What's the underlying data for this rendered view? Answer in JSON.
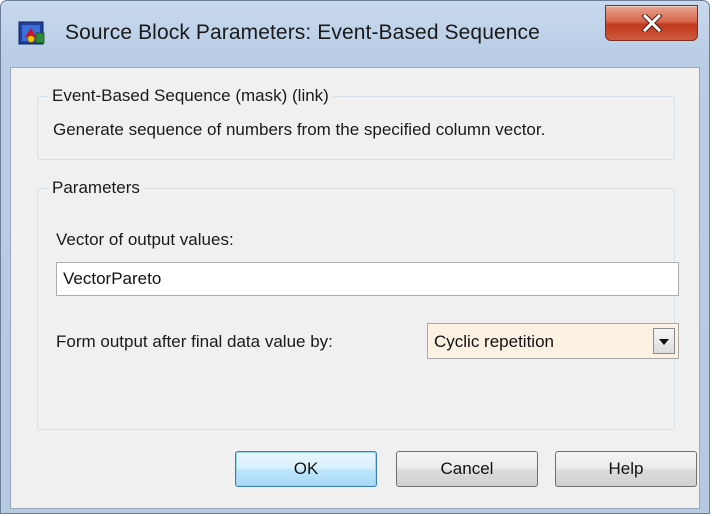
{
  "window": {
    "title": "Source Block Parameters: Event-Based Sequence",
    "app_icon": "simulink-block-icon",
    "close_icon": "close-icon"
  },
  "description_group": {
    "legend": "Event-Based Sequence (mask) (link)",
    "text": "Generate sequence of numbers from the specified column vector."
  },
  "parameters_group": {
    "legend": "Parameters",
    "vector_label": "Vector of output values:",
    "vector_value": "VectorPareto",
    "form_output_label": "Form output after final data value by:",
    "form_output_selected": "Cyclic repetition",
    "dropdown_icon": "chevron-down-icon"
  },
  "buttons": {
    "ok": "OK",
    "cancel": "Cancel",
    "help": "Help"
  },
  "colors": {
    "close_button": "#c7432a",
    "select_background": "#fdf1e1",
    "default_button_border": "#3c7fb1"
  }
}
